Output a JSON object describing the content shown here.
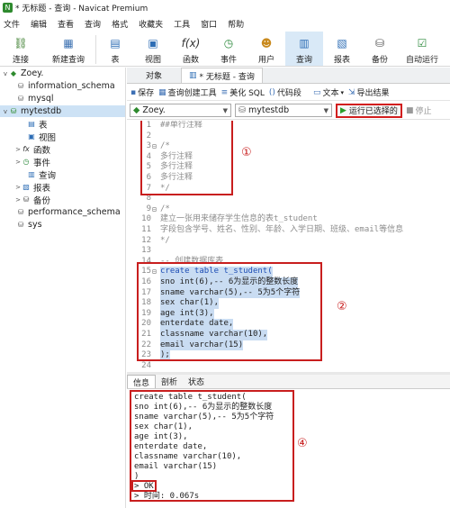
{
  "window": {
    "title": "* 无标题 - 查询 - Navicat Premium"
  },
  "menu": [
    "文件",
    "编辑",
    "查看",
    "查询",
    "格式",
    "收藏夹",
    "工具",
    "窗口",
    "帮助"
  ],
  "toolbar": [
    {
      "label": "连接",
      "icon": "connect-icon"
    },
    {
      "label": "新建查询",
      "icon": "new-query-icon"
    },
    {
      "label": "表",
      "icon": "table-icon"
    },
    {
      "label": "视图",
      "icon": "view-icon"
    },
    {
      "label": "函数",
      "icon": "function-icon"
    },
    {
      "label": "事件",
      "icon": "event-icon"
    },
    {
      "label": "用户",
      "icon": "user-icon"
    },
    {
      "label": "查询",
      "icon": "query-icon"
    },
    {
      "label": "报表",
      "icon": "report-icon"
    },
    {
      "label": "备份",
      "icon": "backup-icon"
    },
    {
      "label": "自动运行",
      "icon": "autorun-icon"
    }
  ],
  "tree": [
    {
      "label": "Zoey.",
      "level": 0,
      "expand": "v",
      "icon": "connection-icon"
    },
    {
      "label": "information_schema",
      "level": 1,
      "expand": "",
      "icon": "database-icon"
    },
    {
      "label": "mysql",
      "level": 1,
      "expand": "",
      "icon": "database-icon"
    },
    {
      "label": "mytestdb",
      "level": 1,
      "expand": "v",
      "icon": "database-icon",
      "selected": true
    },
    {
      "label": "表",
      "level": 2,
      "expand": "",
      "icon": "table-icon"
    },
    {
      "label": "视图",
      "level": 2,
      "expand": "",
      "icon": "view-icon"
    },
    {
      "label": "函数",
      "level": 2,
      "expand": ">",
      "icon": "function-icon"
    },
    {
      "label": "事件",
      "level": 2,
      "expand": ">",
      "icon": "event-icon"
    },
    {
      "label": "查询",
      "level": 2,
      "expand": "",
      "icon": "query-icon"
    },
    {
      "label": "报表",
      "level": 2,
      "expand": ">",
      "icon": "report-icon"
    },
    {
      "label": "备份",
      "level": 2,
      "expand": ">",
      "icon": "backup-icon"
    },
    {
      "label": "performance_schema",
      "level": 1,
      "expand": "",
      "icon": "database-icon"
    },
    {
      "label": "sys",
      "level": 1,
      "expand": "",
      "icon": "database-icon"
    }
  ],
  "tabs": {
    "objects": "对象",
    "query": "* 无标题 - 查询"
  },
  "query_toolbar": {
    "save": "保存",
    "builder": "查询创建工具",
    "beautify": "美化 SQL",
    "snippet": "代码段",
    "text": "文本",
    "export": "导出结果"
  },
  "connection": {
    "server": "Zoey.",
    "database": "mytestdb",
    "run": "运行已选择的",
    "stop": "停止"
  },
  "markers": [
    "①",
    "②",
    "③",
    "④"
  ],
  "code_lines": [
    "##单行注释",
    "",
    "/*",
    "多行注释",
    "多行注释",
    "多行注释",
    "*/",
    "",
    "/*",
    "建立一张用来储存学生信息的表t_student",
    "字段包含学号、姓名、性别、年龄、入学日期、班级、email等信息",
    "*/",
    "",
    "-- 创建数据库表",
    "create table t_student(",
    "sno int(6),-- 6为显示的整数长度",
    "sname varchar(5),-- 5为5个字符",
    "sex char(1),",
    "age int(3),",
    "enterdate date,",
    "classname varchar(10),",
    "email varchar(15)",
    ");",
    ""
  ],
  "result_tabs": [
    "信息",
    "剖析",
    "状态"
  ],
  "result_lines": [
    "create table t_student(",
    "sno int(6),-- 6为显示的整数长度",
    "sname varchar(5),-- 5为5个字符",
    "sex char(1),",
    "age int(3),",
    "enterdate date,",
    "classname varchar(10),",
    "email varchar(15)",
    ")",
    "> OK",
    "> 时间: 0.067s"
  ]
}
